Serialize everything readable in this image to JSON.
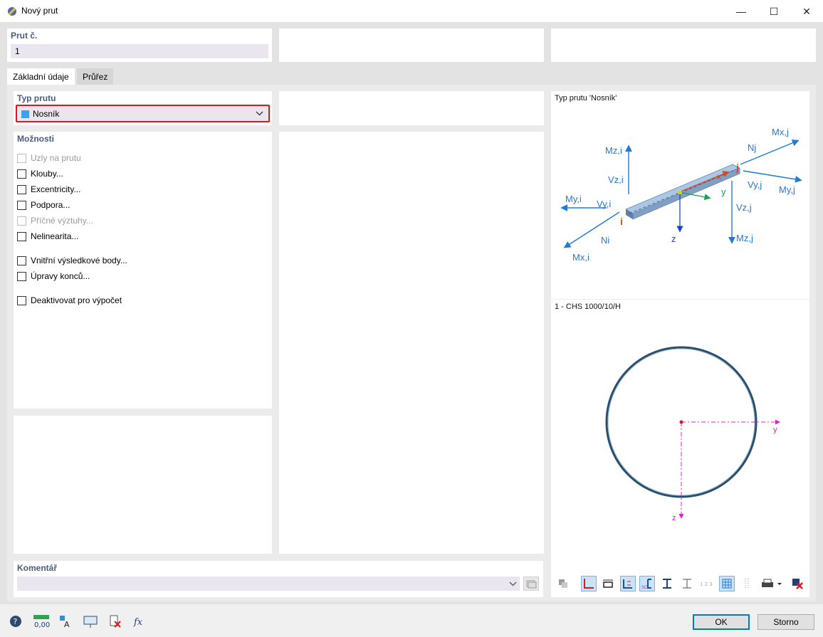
{
  "window": {
    "title": "Nový prut",
    "minimize": "—",
    "maximize": "☐",
    "close": "✕"
  },
  "header": {
    "member_no_label": "Prut č.",
    "member_no_value": "1"
  },
  "tabs": [
    {
      "label": "Základní údaje",
      "active": true
    },
    {
      "label": "Průřez",
      "active": false
    }
  ],
  "member_type": {
    "label": "Typ prutu",
    "value": "Nosník",
    "color": "#3fa0ef"
  },
  "options": {
    "label": "Možnosti",
    "items": [
      {
        "label": "Uzly na prutu",
        "disabled": true,
        "checked": false
      },
      {
        "label": "Klouby...",
        "disabled": false,
        "checked": false
      },
      {
        "label": "Excentricity...",
        "disabled": false,
        "checked": false
      },
      {
        "label": "Podpora...",
        "disabled": false,
        "checked": false
      },
      {
        "label": "Příčné výztuhy...",
        "disabled": true,
        "checked": false
      },
      {
        "label": "Nelinearita...",
        "disabled": false,
        "checked": false
      },
      {
        "label": "Vnitřní výsledkové body...",
        "disabled": false,
        "checked": false
      },
      {
        "label": "Úpravy konců...",
        "disabled": false,
        "checked": false
      },
      {
        "label": "Deaktivovat pro výpočet",
        "disabled": false,
        "checked": false
      }
    ]
  },
  "comment": {
    "label": "Komentář",
    "value": ""
  },
  "diagram": {
    "title": "Typ prutu 'Nosník'",
    "labels": {
      "mzi": "Mz,i",
      "vzi": "Vz,i",
      "myi": "My,i",
      "vyi": "Vy,i",
      "ni": "Ni",
      "mxi": "Mx,i",
      "nj": "Nj",
      "mxj": "Mx,j",
      "vyj": "Vy,j",
      "myj": "My,j",
      "vzj": "Vz,j",
      "mzj": "Mz,j",
      "node_i": "i",
      "node_j": "j",
      "axis_x": "x",
      "axis_y": "y",
      "axis_z": "z"
    },
    "arrow_color": "#1e7bd6",
    "node_color": "#e2441b"
  },
  "section": {
    "title": "1 - CHS 1000/10/H",
    "axis_y": "y",
    "axis_z": "z",
    "axis_color": "#e020d0"
  },
  "dialog_buttons": {
    "ok": "OK",
    "cancel": "Storno"
  }
}
